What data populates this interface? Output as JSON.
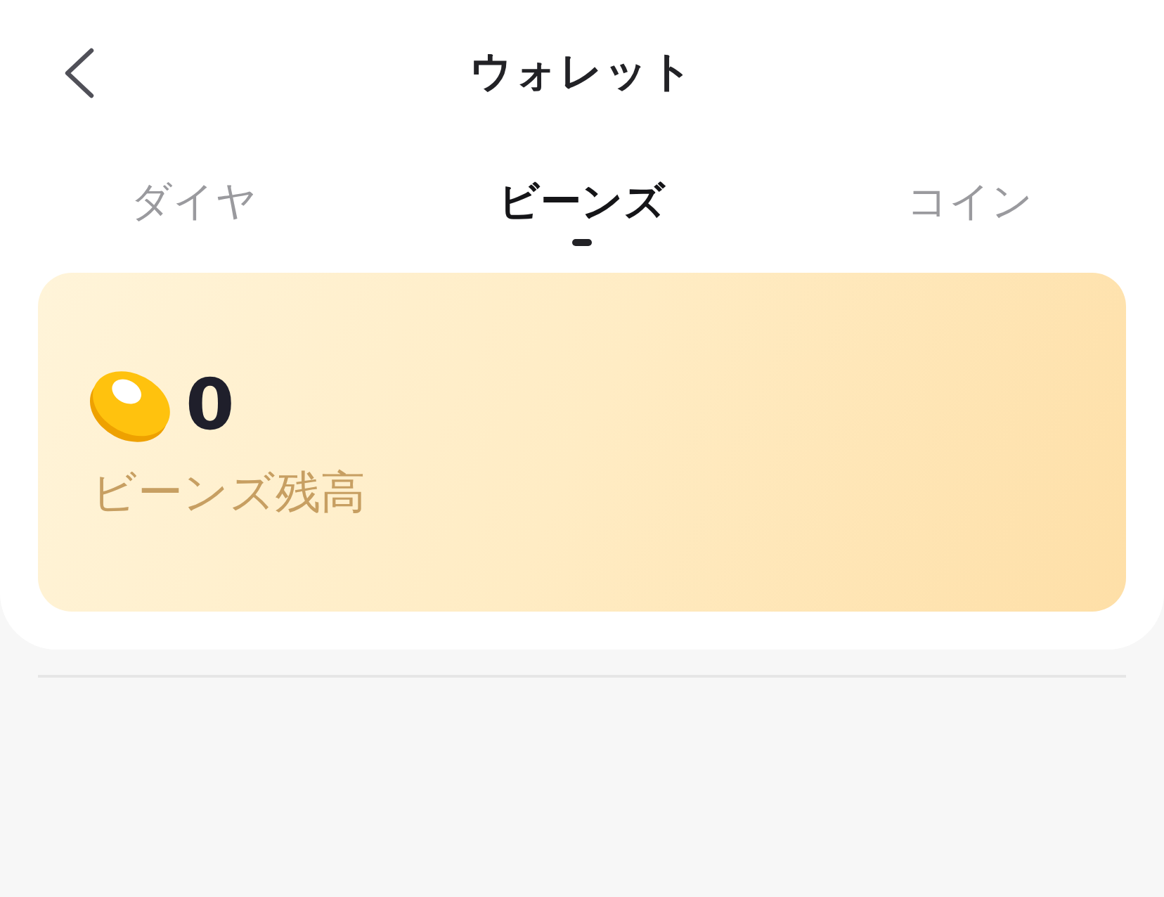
{
  "header": {
    "title": "ウォレット"
  },
  "tabs": [
    {
      "label": "ダイヤ",
      "selected": false
    },
    {
      "label": "ビーンズ",
      "selected": true
    },
    {
      "label": "コイン",
      "selected": false
    }
  ],
  "balance_card": {
    "amount": "0",
    "label": "ビーンズ残高"
  }
}
